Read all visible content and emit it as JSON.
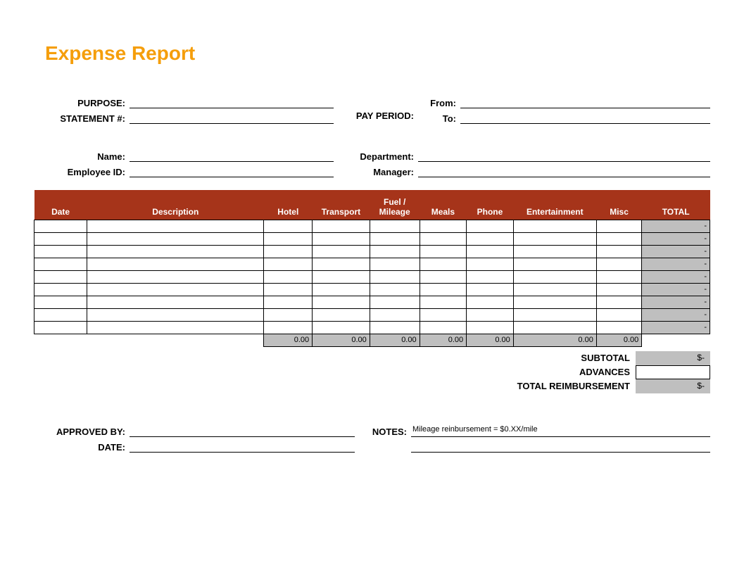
{
  "title": "Expense Report",
  "info": {
    "purpose_label": "PURPOSE:",
    "statement_label": "STATEMENT #:",
    "payperiod_label": "PAY PERIOD:",
    "from_label": "From:",
    "to_label": "To:",
    "name_label": "Name:",
    "empid_label": "Employee ID:",
    "dept_label": "Department:",
    "manager_label": "Manager:",
    "purpose": "",
    "statement": "",
    "from": "",
    "to": "",
    "name": "",
    "empid": "",
    "dept": "",
    "manager": ""
  },
  "columns": {
    "date": "Date",
    "desc": "Description",
    "hotel": "Hotel",
    "transport": "Transport",
    "fuel": "Fuel / Mileage",
    "meals": "Meals",
    "phone": "Phone",
    "ent": "Entertainment",
    "misc": "Misc",
    "total": "TOTAL"
  },
  "rows": [
    {
      "date": "",
      "desc": "",
      "hotel": "",
      "transport": "",
      "fuel": "",
      "meals": "",
      "phone": "",
      "ent": "",
      "misc": "",
      "total": "-"
    },
    {
      "date": "",
      "desc": "",
      "hotel": "",
      "transport": "",
      "fuel": "",
      "meals": "",
      "phone": "",
      "ent": "",
      "misc": "",
      "total": "-"
    },
    {
      "date": "",
      "desc": "",
      "hotel": "",
      "transport": "",
      "fuel": "",
      "meals": "",
      "phone": "",
      "ent": "",
      "misc": "",
      "total": "-"
    },
    {
      "date": "",
      "desc": "",
      "hotel": "",
      "transport": "",
      "fuel": "",
      "meals": "",
      "phone": "",
      "ent": "",
      "misc": "",
      "total": "-"
    },
    {
      "date": "",
      "desc": "",
      "hotel": "",
      "transport": "",
      "fuel": "",
      "meals": "",
      "phone": "",
      "ent": "",
      "misc": "",
      "total": "-"
    },
    {
      "date": "",
      "desc": "",
      "hotel": "",
      "transport": "",
      "fuel": "",
      "meals": "",
      "phone": "",
      "ent": "",
      "misc": "",
      "total": "-"
    },
    {
      "date": "",
      "desc": "",
      "hotel": "",
      "transport": "",
      "fuel": "",
      "meals": "",
      "phone": "",
      "ent": "",
      "misc": "",
      "total": "-"
    },
    {
      "date": "",
      "desc": "",
      "hotel": "",
      "transport": "",
      "fuel": "",
      "meals": "",
      "phone": "",
      "ent": "",
      "misc": "",
      "total": "-"
    },
    {
      "date": "",
      "desc": "",
      "hotel": "",
      "transport": "",
      "fuel": "",
      "meals": "",
      "phone": "",
      "ent": "",
      "misc": "",
      "total": "-"
    }
  ],
  "column_totals": {
    "hotel": "0.00",
    "transport": "0.00",
    "fuel": "0.00",
    "meals": "0.00",
    "phone": "0.00",
    "ent": "0.00",
    "misc": "0.00"
  },
  "summary": {
    "subtotal_label": "SUBTOTAL",
    "subtotal": "$-",
    "advances_label": "ADVANCES",
    "advances": "",
    "totalreimb_label": "TOTAL REIMBURSEMENT",
    "totalreimb": "$-"
  },
  "footer": {
    "approved_label": "APPROVED BY:",
    "date_label": "DATE:",
    "notes_label": "NOTES:",
    "notes": "Mileage reinbursement = $0.XX/mile",
    "approved": "",
    "date": ""
  }
}
